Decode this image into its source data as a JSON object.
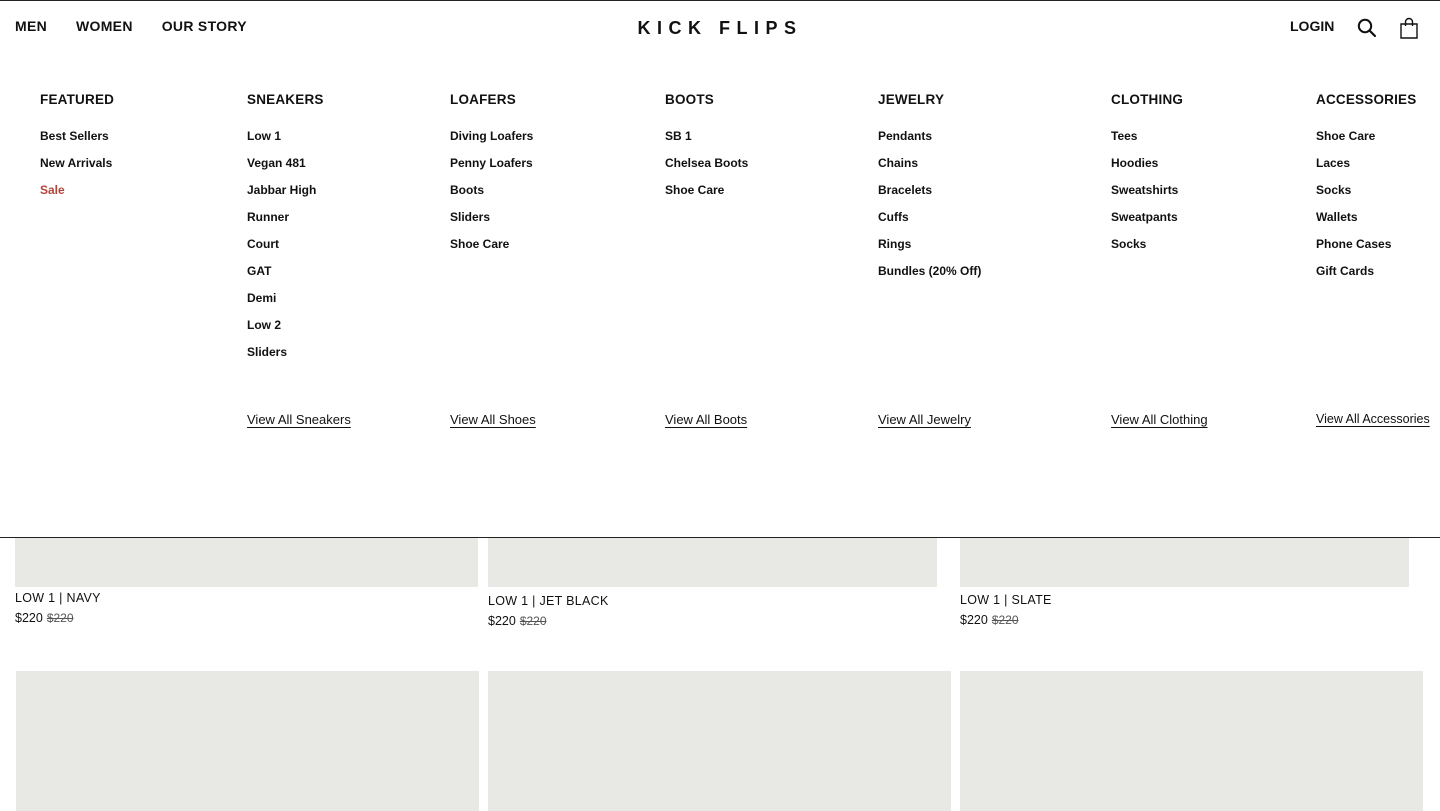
{
  "header": {
    "nav": [
      "MEN",
      "WOMEN",
      "OUR STORY"
    ],
    "logo": "KICK FLIPS",
    "login": "LOGIN",
    "icons": [
      "search-icon",
      "shopping-bag-icon"
    ]
  },
  "menu": {
    "featured": {
      "title": "FEATURED",
      "items": [
        "Best Sellers",
        "New Arrivals",
        "Sale"
      ]
    },
    "sneakers": {
      "title": "SNEAKERS",
      "items": [
        "Low 1",
        "Vegan 481",
        "Jabbar High",
        "Runner",
        "Court",
        "GAT",
        "Demi",
        "Low 2",
        "Sliders"
      ],
      "view_all": "View All Sneakers"
    },
    "loafers": {
      "title": "LOAFERS",
      "items": [
        "Diving Loafers",
        "Penny Loafers",
        "Boots",
        "Sliders",
        "Shoe Care"
      ],
      "view_all": "View All Shoes"
    },
    "boots": {
      "title": "BOOTS",
      "items": [
        "SB 1",
        "Chelsea Boots",
        "Shoe Care"
      ],
      "view_all": "View All Boots"
    },
    "jewelry": {
      "title": "JEWELRY",
      "items": [
        "Pendants",
        "Chains",
        "Bracelets",
        "Cuffs",
        "Rings",
        "Bundles (20% Off)"
      ],
      "view_all": "View All Jewelry"
    },
    "clothing": {
      "title": "CLOTHING",
      "items": [
        "Tees",
        "Hoodies",
        "Sweatshirts",
        "Sweatpants",
        "Socks"
      ],
      "view_all": "View All Clothing"
    },
    "accessories": {
      "title": "ACCESSORIES",
      "items": [
        "Shoe Care",
        "Laces",
        "Socks",
        "Wallets",
        "Phone Cases",
        "Gift Cards"
      ],
      "view_all": "View All Accessories"
    }
  },
  "products": [
    {
      "name": "LOW 1 | NAVY",
      "price": "$220",
      "compare_price": "$220"
    },
    {
      "name": "LOW 1 | JET BLACK",
      "price": "$220",
      "compare_price": "$220"
    },
    {
      "name": "LOW 1 | SLATE",
      "price": "$220",
      "compare_price": "$220"
    }
  ],
  "colors": {
    "sale": "#b2443a",
    "tile": "#e8e8e4",
    "text": "#111111"
  }
}
